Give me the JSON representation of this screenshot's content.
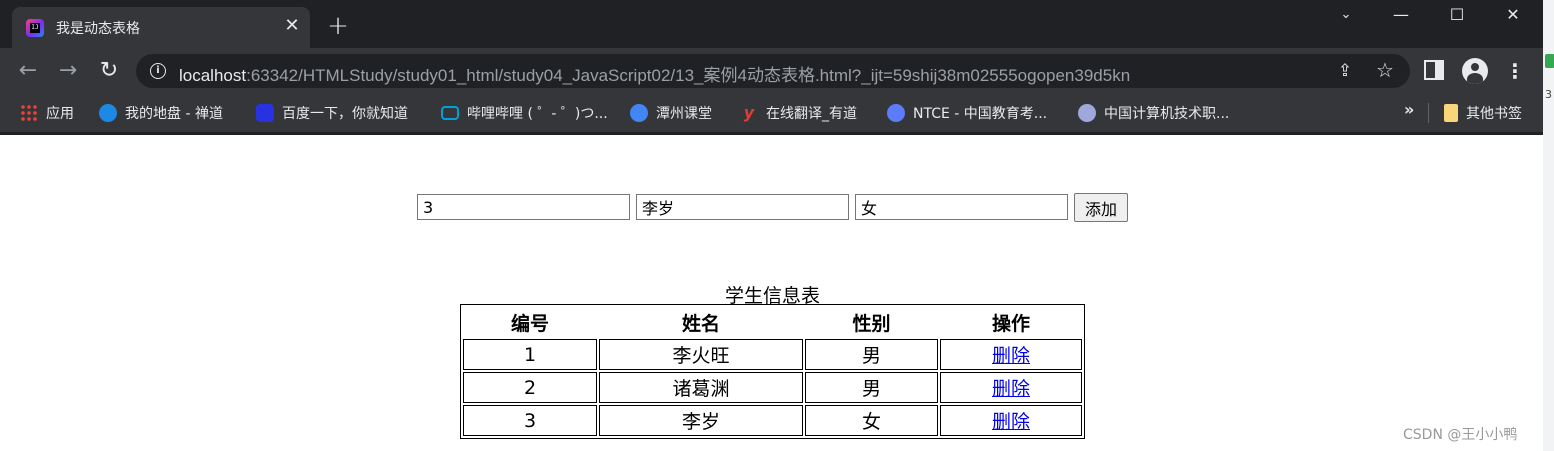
{
  "tab": {
    "title": "我是动态表格",
    "close": "✕",
    "new_tab": "+"
  },
  "window_controls": {
    "tab_search": "⌄",
    "minimize": "—",
    "maximize": "☐",
    "close": "✕"
  },
  "toolbar": {
    "back": "←",
    "forward": "→",
    "reload": "↻",
    "url_host": "localhost",
    "url_rest": ":63342/HTMLStudy/study01_html/study04_JavaScript02/13_案例4动态表格.html?_ijt=59shij38m02555ogopen39d5kn",
    "info_icon": "i",
    "share_icon": "⇪",
    "star_icon": "☆",
    "menu_icon": "⋮"
  },
  "bookmarks": {
    "items": [
      {
        "label": "应用",
        "icon": "apps-icon"
      },
      {
        "label": "我的地盘 - 禅道",
        "icon": "zentao-icon"
      },
      {
        "label": "百度一下，你就知道",
        "icon": "baidu-icon"
      },
      {
        "label": "哔哩哔哩 ( ゜- ゜)つ...",
        "icon": "bilibili-icon"
      },
      {
        "label": "潭州课堂",
        "icon": "tanzhou-icon"
      },
      {
        "label": "在线翻译_有道",
        "icon": "youdao-icon",
        "glyph": "y"
      },
      {
        "label": "NTCE - 中国教育考...",
        "icon": "ntce-icon"
      },
      {
        "label": "中国计算机技术职...",
        "icon": "computer-cert-icon"
      }
    ],
    "more": "»",
    "other_bookmarks": "其他书签"
  },
  "form": {
    "id_value": "3",
    "name_value": "李岁",
    "gender_value": "女",
    "add_button": "添加"
  },
  "table": {
    "caption": "学生信息表",
    "headers": [
      "编号",
      "姓名",
      "性别",
      "操作"
    ],
    "rows": [
      {
        "id": "1",
        "name": "李火旺",
        "gender": "男",
        "action": "删除"
      },
      {
        "id": "2",
        "name": "诸葛渊",
        "gender": "男",
        "action": "删除"
      },
      {
        "id": "3",
        "name": "李岁",
        "gender": "女",
        "action": "删除"
      }
    ]
  },
  "side_strip_text": "3",
  "watermark": "CSDN @王小小鸭",
  "colors": {
    "chrome_dark": "#202124",
    "toolbar": "#35363a",
    "link": "#0000ee"
  }
}
